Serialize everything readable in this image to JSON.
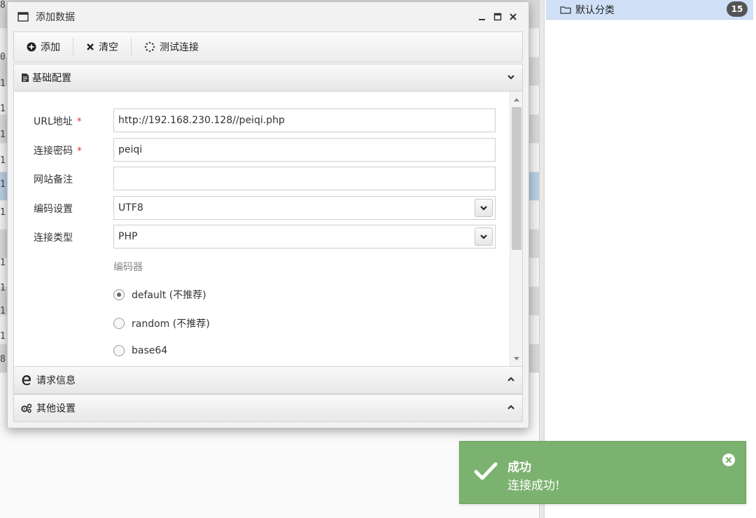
{
  "background": {
    "row_numbers": [
      "8",
      "0",
      "1",
      "1",
      "1",
      "1",
      "1",
      "1",
      "1",
      "1",
      "1",
      "1",
      "8"
    ],
    "category": {
      "label": "默认分类",
      "count": "15",
      "icon": "folder-icon"
    }
  },
  "dialog": {
    "title": "添加数据",
    "toolbar": {
      "add_label": "添加",
      "clear_label": "清空",
      "test_label": "测试连接"
    },
    "sections": {
      "basic": "基础配置",
      "request": "请求信息",
      "other": "其他设置"
    },
    "form": {
      "url": {
        "label": "URL地址",
        "required": "*",
        "value": "http://192.168.230.128//peiqi.php"
      },
      "password": {
        "label": "连接密码",
        "required": "*",
        "value": "peiqi"
      },
      "note": {
        "label": "网站备注",
        "value": ""
      },
      "encoding": {
        "label": "编码设置",
        "value": "UTF8"
      },
      "type": {
        "label": "连接类型",
        "value": "PHP"
      },
      "encoder": {
        "label": "编码器",
        "options": [
          {
            "label": "default (不推荐)",
            "selected": true
          },
          {
            "label": "random (不推荐)",
            "selected": false
          },
          {
            "label": "base64",
            "selected": false
          }
        ]
      }
    }
  },
  "toast": {
    "title": "成功",
    "message": "连接成功!",
    "color": "#7cb26f"
  }
}
